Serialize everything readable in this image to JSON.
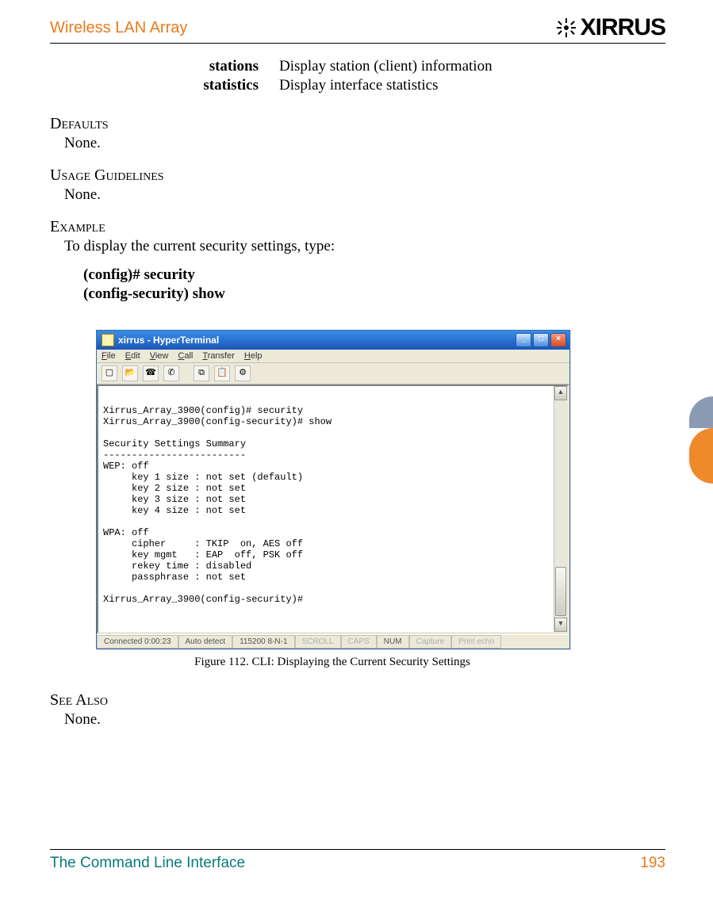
{
  "header": {
    "title": "Wireless LAN Array",
    "logo_text": "XIRRUS"
  },
  "definitions": [
    {
      "term": "stations",
      "desc": "Display station (client) information"
    },
    {
      "term": "statistics",
      "desc": "Display interface statistics"
    }
  ],
  "sections": {
    "defaults": {
      "head": "Defaults",
      "body": "None."
    },
    "usage": {
      "head": "Usage Guidelines",
      "body": "None."
    },
    "example": {
      "head": "Example",
      "body": "To display the current security settings, type:"
    },
    "seealso": {
      "head": "See Also",
      "body": "None."
    }
  },
  "example_commands": [
    "(config)# security",
    "(config-security) show"
  ],
  "terminal_window": {
    "title": "xirrus - HyperTerminal",
    "menu": [
      "File",
      "Edit",
      "View",
      "Call",
      "Transfer",
      "Help"
    ],
    "toolbar_icons": [
      "new-doc-icon",
      "open-icon",
      "connect-icon",
      "disconnect-icon",
      "copy-icon",
      "paste-icon",
      "properties-icon"
    ],
    "output": "\nXirrus_Array_3900(config)# security\nXirrus_Array_3900(config-security)# show\n\nSecurity Settings Summary\n-------------------------\nWEP: off\n     key 1 size : not set (default)\n     key 2 size : not set\n     key 3 size : not set\n     key 4 size : not set\n\nWPA: off\n     cipher     : TKIP  on, AES off\n     key mgmt   : EAP  off, PSK off\n     rekey time : disabled\n     passphrase : not set\n\nXirrus_Array_3900(config-security)#",
    "statusbar": {
      "connected": "Connected 0:00:23",
      "detect": "Auto detect",
      "port": "115200 8-N-1",
      "scroll": "SCROLL",
      "caps": "CAPS",
      "num": "NUM",
      "capture": "Capture",
      "printecho": "Print echo"
    }
  },
  "figure_caption": "Figure 112. CLI: Displaying the Current Security Settings",
  "footer": {
    "left": "The Command Line Interface",
    "right": "193"
  }
}
